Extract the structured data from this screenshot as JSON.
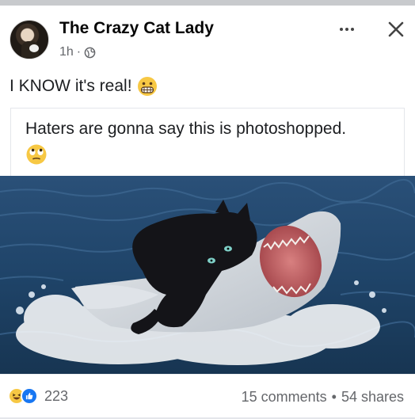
{
  "post": {
    "author": "The Crazy Cat Lady",
    "time": "1h",
    "separator": "·",
    "text": "I KNOW it's real!",
    "quote": "Haters are gonna say this is photoshopped.",
    "image_alt": "Black cat riding a breaching great white shark"
  },
  "icons": {
    "more": "more-options-icon",
    "close": "close-icon",
    "privacy": "globe-icon",
    "grimace": "grimacing-face-emoji",
    "eyeroll": "face-with-rolling-eyes-emoji",
    "haha": "haha-reaction-icon",
    "like": "like-reaction-icon"
  },
  "footer": {
    "reaction_count": "223",
    "comments": "15 comments",
    "dot": "•",
    "shares": "54 shares"
  },
  "colors": {
    "secondary_text": "#65676b",
    "like_blue": "#1877f2",
    "haha_yellow": "#f7c844"
  }
}
